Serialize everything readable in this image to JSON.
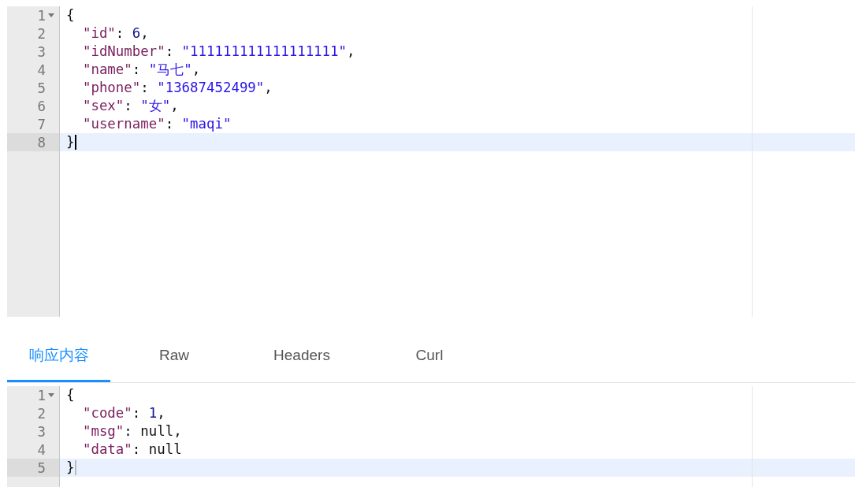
{
  "request_editor": {
    "focused": true,
    "lines": [
      {
        "number": "1",
        "foldable": true,
        "active": false,
        "tokens": [
          {
            "kind": "punct",
            "text": "{"
          }
        ]
      },
      {
        "number": "2",
        "foldable": false,
        "active": false,
        "tokens": [
          {
            "kind": "key",
            "text": "  \"id\""
          },
          {
            "kind": "punct",
            "text": ": "
          },
          {
            "kind": "number",
            "text": "6"
          },
          {
            "kind": "punct",
            "text": ","
          }
        ]
      },
      {
        "number": "3",
        "foldable": false,
        "active": false,
        "tokens": [
          {
            "kind": "key",
            "text": "  \"idNumber\""
          },
          {
            "kind": "punct",
            "text": ": "
          },
          {
            "kind": "string",
            "text": "\"111111111111111111\""
          },
          {
            "kind": "punct",
            "text": ","
          }
        ]
      },
      {
        "number": "4",
        "foldable": false,
        "active": false,
        "tokens": [
          {
            "kind": "key",
            "text": "  \"name\""
          },
          {
            "kind": "punct",
            "text": ": "
          },
          {
            "kind": "string",
            "text": "\"马七\""
          },
          {
            "kind": "punct",
            "text": ","
          }
        ]
      },
      {
        "number": "5",
        "foldable": false,
        "active": false,
        "tokens": [
          {
            "kind": "key",
            "text": "  \"phone\""
          },
          {
            "kind": "punct",
            "text": ": "
          },
          {
            "kind": "string",
            "text": "\"13687452499\""
          },
          {
            "kind": "punct",
            "text": ","
          }
        ]
      },
      {
        "number": "6",
        "foldable": false,
        "active": false,
        "tokens": [
          {
            "kind": "key",
            "text": "  \"sex\""
          },
          {
            "kind": "punct",
            "text": ": "
          },
          {
            "kind": "string",
            "text": "\"女\""
          },
          {
            "kind": "punct",
            "text": ","
          }
        ]
      },
      {
        "number": "7",
        "foldable": false,
        "active": false,
        "tokens": [
          {
            "kind": "key",
            "text": "  \"username\""
          },
          {
            "kind": "punct",
            "text": ": "
          },
          {
            "kind": "string",
            "text": "\"maqi\""
          }
        ]
      },
      {
        "number": "8",
        "foldable": false,
        "active": true,
        "tokens": [
          {
            "kind": "punct",
            "text": "}"
          }
        ]
      }
    ]
  },
  "tabs": [
    {
      "label": "响应内容",
      "selected": true
    },
    {
      "label": "Raw",
      "selected": false
    },
    {
      "label": "Headers",
      "selected": false
    },
    {
      "label": "Curl",
      "selected": false
    }
  ],
  "response_editor": {
    "focused": false,
    "lines": [
      {
        "number": "1",
        "foldable": true,
        "active": false,
        "tokens": [
          {
            "kind": "punct",
            "text": "{"
          }
        ]
      },
      {
        "number": "2",
        "foldable": false,
        "active": false,
        "tokens": [
          {
            "kind": "key",
            "text": "  \"code\""
          },
          {
            "kind": "punct",
            "text": ": "
          },
          {
            "kind": "number",
            "text": "1"
          },
          {
            "kind": "punct",
            "text": ","
          }
        ]
      },
      {
        "number": "3",
        "foldable": false,
        "active": false,
        "tokens": [
          {
            "kind": "key",
            "text": "  \"msg\""
          },
          {
            "kind": "punct",
            "text": ": "
          },
          {
            "kind": "null",
            "text": "null"
          },
          {
            "kind": "punct",
            "text": ","
          }
        ]
      },
      {
        "number": "4",
        "foldable": false,
        "active": false,
        "tokens": [
          {
            "kind": "key",
            "text": "  \"data\""
          },
          {
            "kind": "punct",
            "text": ": "
          },
          {
            "kind": "null",
            "text": "null"
          }
        ]
      },
      {
        "number": "5",
        "foldable": false,
        "active": true,
        "tokens": [
          {
            "kind": "punct",
            "text": "}"
          }
        ]
      }
    ]
  }
}
